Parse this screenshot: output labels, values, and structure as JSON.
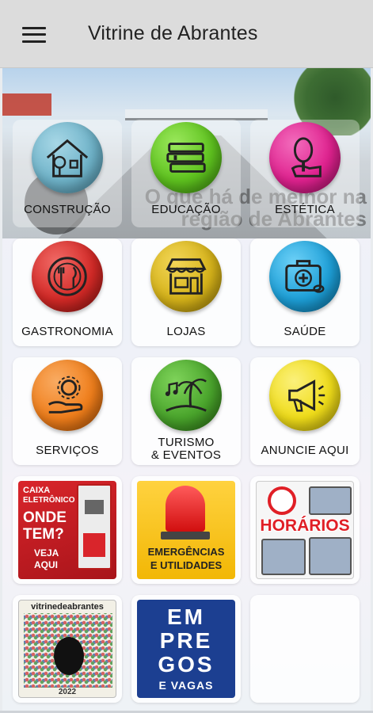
{
  "appbar": {
    "title": "Vitrine de Abrantes"
  },
  "hero": {
    "overlay_text": "O que há de melhor na região de Abrantes"
  },
  "categories": [
    {
      "label": "CONSTRUÇÃO",
      "icon": "house-icon",
      "color": "#6fb3c9"
    },
    {
      "label": "EDUCAÇÃO",
      "icon": "books-icon",
      "color": "#5fc31f"
    },
    {
      "label": "ESTÉTICA",
      "icon": "mirror-icon",
      "color": "#e0228f"
    },
    {
      "label": "GASTRONOMIA",
      "icon": "plate-cutlery-icon",
      "color": "#d42a27"
    },
    {
      "label": "LOJAS",
      "icon": "storefront-icon",
      "color": "#d6b31a"
    },
    {
      "label": "SAÚDE",
      "icon": "medical-kit-icon",
      "color": "#1ea0d8"
    },
    {
      "label": "SERVIÇOS",
      "icon": "gear-hand-icon",
      "color": "#f07f1c"
    },
    {
      "label": "TURISMO\n& EVENTOS",
      "label_line1": "TURISMO",
      "label_line2": "& EVENTOS",
      "icon": "palm-island-icon",
      "color": "#4aa52c"
    },
    {
      "label": "ANUNCIE AQUI",
      "icon": "megaphone-icon",
      "color": "#f0dd1a"
    }
  ],
  "promos": {
    "atm": {
      "line1": "CAIXA",
      "line2": "ELETRÔNICO",
      "line3": "ONDE",
      "line4": "TEM?",
      "line5": "VEJA",
      "line6": "AQUI"
    },
    "emergency": {
      "line1": "EMERGÊNCIAS",
      "line2": "E UTILIDADES"
    },
    "schedules": {
      "label": "HORÁRIOS"
    },
    "vitrine": {
      "title": "vitrinedeabrantes",
      "year": "2022"
    },
    "jobs": {
      "line1": "EM",
      "line2": "PRE",
      "line3": "GOS",
      "line4": "E VAGAS"
    }
  }
}
